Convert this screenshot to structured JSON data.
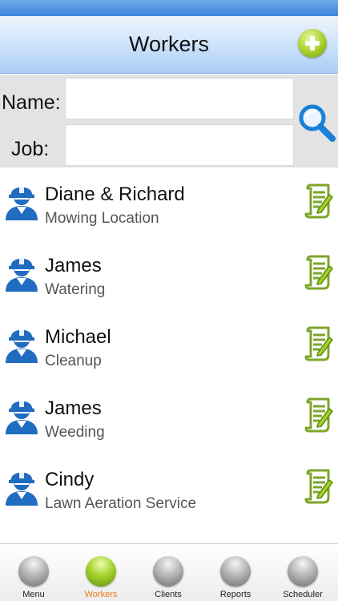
{
  "header": {
    "title": "Workers"
  },
  "search": {
    "name_label": "Name:",
    "job_label": "Job:",
    "name_value": "",
    "job_value": ""
  },
  "workers": [
    {
      "name": "Diane & Richard",
      "job": "Mowing Location"
    },
    {
      "name": "James",
      "job": "Watering"
    },
    {
      "name": "Michael",
      "job": "Cleanup"
    },
    {
      "name": "James",
      "job": "Weeding"
    },
    {
      "name": "Cindy",
      "job": "Lawn Aeration Service"
    }
  ],
  "tabs": [
    {
      "label": "Menu",
      "active": false
    },
    {
      "label": "Workers",
      "active": true
    },
    {
      "label": "Clients",
      "active": false
    },
    {
      "label": "Reports",
      "active": false
    },
    {
      "label": "Scheduler",
      "active": false
    }
  ],
  "colors": {
    "accent_green": "#a7cf2b",
    "header_blue": "#a9cdf5",
    "worker_blue": "#1f6cc0",
    "active_tab": "#e87a1c"
  }
}
